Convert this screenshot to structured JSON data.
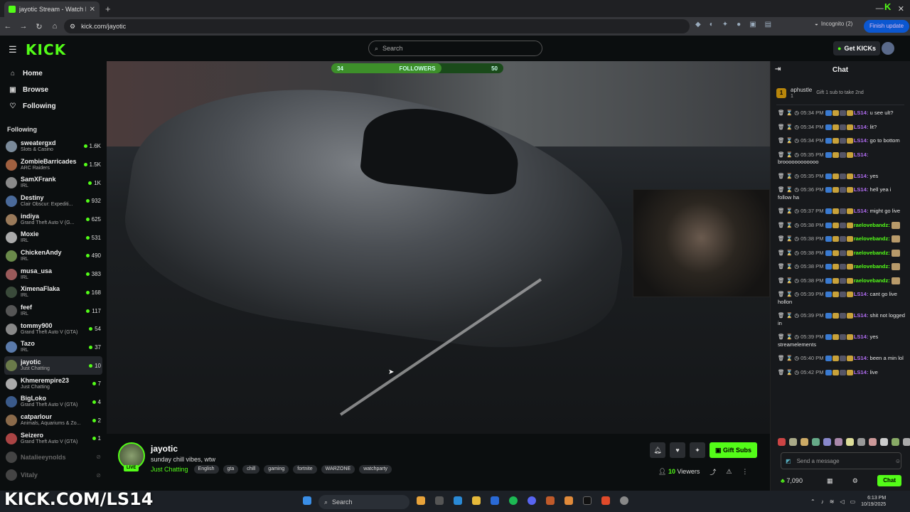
{
  "browser": {
    "tab_title": "jayotic Stream - Watch Live",
    "new_tab": "+",
    "url": "kick.com/jayotic",
    "incognito": "Incognito (2)",
    "finish_update": "Finish update",
    "minimize": "—",
    "close": "✕"
  },
  "header": {
    "logo": "KICK",
    "search_placeholder": "Search",
    "get_kicks": "Get KICKs"
  },
  "sidebar": {
    "nav": [
      {
        "label": "Home",
        "icon": "home-icon"
      },
      {
        "label": "Browse",
        "icon": "browse-icon"
      },
      {
        "label": "Following",
        "icon": "heart-icon"
      }
    ],
    "following_title": "Following",
    "following": [
      {
        "name": "sweatergxd",
        "cat": "Slots & Casino",
        "count": "1.6K",
        "color": "#7a8a9a"
      },
      {
        "name": "ZombieBarricades",
        "cat": "ARC Raiders",
        "count": "1.5K",
        "color": "#a06040"
      },
      {
        "name": "SamXFrank",
        "cat": "IRL",
        "count": "1K",
        "color": "#8a8a8a"
      },
      {
        "name": "Destiny",
        "cat": "Clair Obscur: Expediti...",
        "count": "932",
        "color": "#4a6a9a"
      },
      {
        "name": "indiya",
        "cat": "Grand Theft Auto V (G...",
        "count": "625",
        "color": "#9a7a5a"
      },
      {
        "name": "Moxie",
        "cat": "IRL",
        "count": "531",
        "color": "#aaa"
      },
      {
        "name": "ChickenAndy",
        "cat": "IRL",
        "count": "490",
        "color": "#6a8a4a"
      },
      {
        "name": "musa_usa",
        "cat": "IRL",
        "count": "383",
        "color": "#9a5a5a"
      },
      {
        "name": "XimenaFlaka",
        "cat": "IRL",
        "count": "168",
        "color": "#3a4a3a"
      },
      {
        "name": "feef",
        "cat": "IRL",
        "count": "117",
        "color": "#555"
      },
      {
        "name": "tommy900",
        "cat": "Grand Theft Auto V (GTA)",
        "count": "54",
        "color": "#888"
      },
      {
        "name": "Tazo",
        "cat": "IRL",
        "count": "37",
        "color": "#5a7aaa"
      },
      {
        "name": "jayotic",
        "cat": "Just Chatting",
        "count": "10",
        "color": "#6a7a4a"
      },
      {
        "name": "Khmerempire23",
        "cat": "Just Chatting",
        "count": "7",
        "color": "#aaa"
      },
      {
        "name": "BigLoko",
        "cat": "Grand Theft Auto V (GTA)",
        "count": "4",
        "color": "#3a5a8a"
      },
      {
        "name": "catparlour",
        "cat": "Animals, Aquariums & Zo...",
        "count": "2",
        "color": "#8a6a4a"
      },
      {
        "name": "Seizero",
        "cat": "Grand Theft Auto V (GTA)",
        "count": "1",
        "color": "#aa4444"
      },
      {
        "name": "Natalieeynolds",
        "cat": "",
        "count": "",
        "color": "#444"
      },
      {
        "name": "Vitaly",
        "cat": "",
        "count": "",
        "color": "#444"
      }
    ]
  },
  "video": {
    "followers_start": "34",
    "followers_label": "FOLLOWERS",
    "followers_goal": "50",
    "followers_progress": 0.64
  },
  "stream": {
    "name": "jayotic",
    "live": "LIVE",
    "title": "sunday chill vibes, wtw",
    "category": "Just Chatting",
    "tags": [
      "English",
      "gta",
      "chill",
      "gaming",
      "fortnite",
      "WARZONE",
      "watchparty"
    ],
    "gift_subs": "Gift Subs",
    "viewers_count": "10",
    "viewers_label": "Viewers"
  },
  "chat": {
    "title": "Chat",
    "pinned_user": "aphustle",
    "pinned_rank": "1",
    "pinned_sub": "1",
    "pinned_msg": "Gift 1 sub to take 2nd",
    "messages": [
      {
        "time": "05:34 PM",
        "user": "LS14:",
        "text": "u see ult?",
        "color": "#b06cf0"
      },
      {
        "time": "05:34 PM",
        "user": "LS14:",
        "text": "lit?",
        "color": "#b06cf0"
      },
      {
        "time": "05:34 PM",
        "user": "LS14:",
        "text": "go to bottom",
        "color": "#b06cf0"
      },
      {
        "time": "05:35 PM",
        "user": "LS14:",
        "text": "broooooooooooo",
        "color": "#b06cf0"
      },
      {
        "time": "05:35 PM",
        "user": "LS14:",
        "text": "yes",
        "color": "#b06cf0"
      },
      {
        "time": "05:36 PM",
        "user": "LS14:",
        "text": "hell yea i follow ha",
        "color": "#b06cf0"
      },
      {
        "time": "05:37 PM",
        "user": "LS14:",
        "text": "might go live",
        "color": "#b06cf0"
      },
      {
        "time": "05:38 PM",
        "user": "raelovebandz:",
        "text": "",
        "color": "#53fc18"
      },
      {
        "time": "05:38 PM",
        "user": "raelovebandz:",
        "text": "",
        "color": "#53fc18"
      },
      {
        "time": "05:38 PM",
        "user": "raelovebandz:",
        "text": "",
        "color": "#53fc18"
      },
      {
        "time": "05:38 PM",
        "user": "raelovebandz:",
        "text": "",
        "color": "#53fc18"
      },
      {
        "time": "05:38 PM",
        "user": "raelovebandz:",
        "text": "",
        "color": "#53fc18"
      },
      {
        "time": "05:39 PM",
        "user": "LS14:",
        "text": "cant go live hollon",
        "color": "#b06cf0"
      },
      {
        "time": "05:39 PM",
        "user": "LS14:",
        "text": "shit not logged in",
        "color": "#b06cf0"
      },
      {
        "time": "05:39 PM",
        "user": "LS14:",
        "text": "yes streamelements",
        "color": "#b06cf0"
      },
      {
        "time": "05:40 PM",
        "user": "LS14:",
        "text": "been a min lol",
        "color": "#b06cf0"
      },
      {
        "time": "05:42 PM",
        "user": "LS14:",
        "text": "live",
        "color": "#b06cf0"
      }
    ],
    "input_placeholder": "Send a message",
    "kicks_balance": "7,090",
    "chat_button": "Chat"
  },
  "overlay": {
    "watermark": "KICK.COM/LS14"
  },
  "taskbar": {
    "search": "Search",
    "time": "6:13 PM",
    "date": "10/19/2025"
  }
}
